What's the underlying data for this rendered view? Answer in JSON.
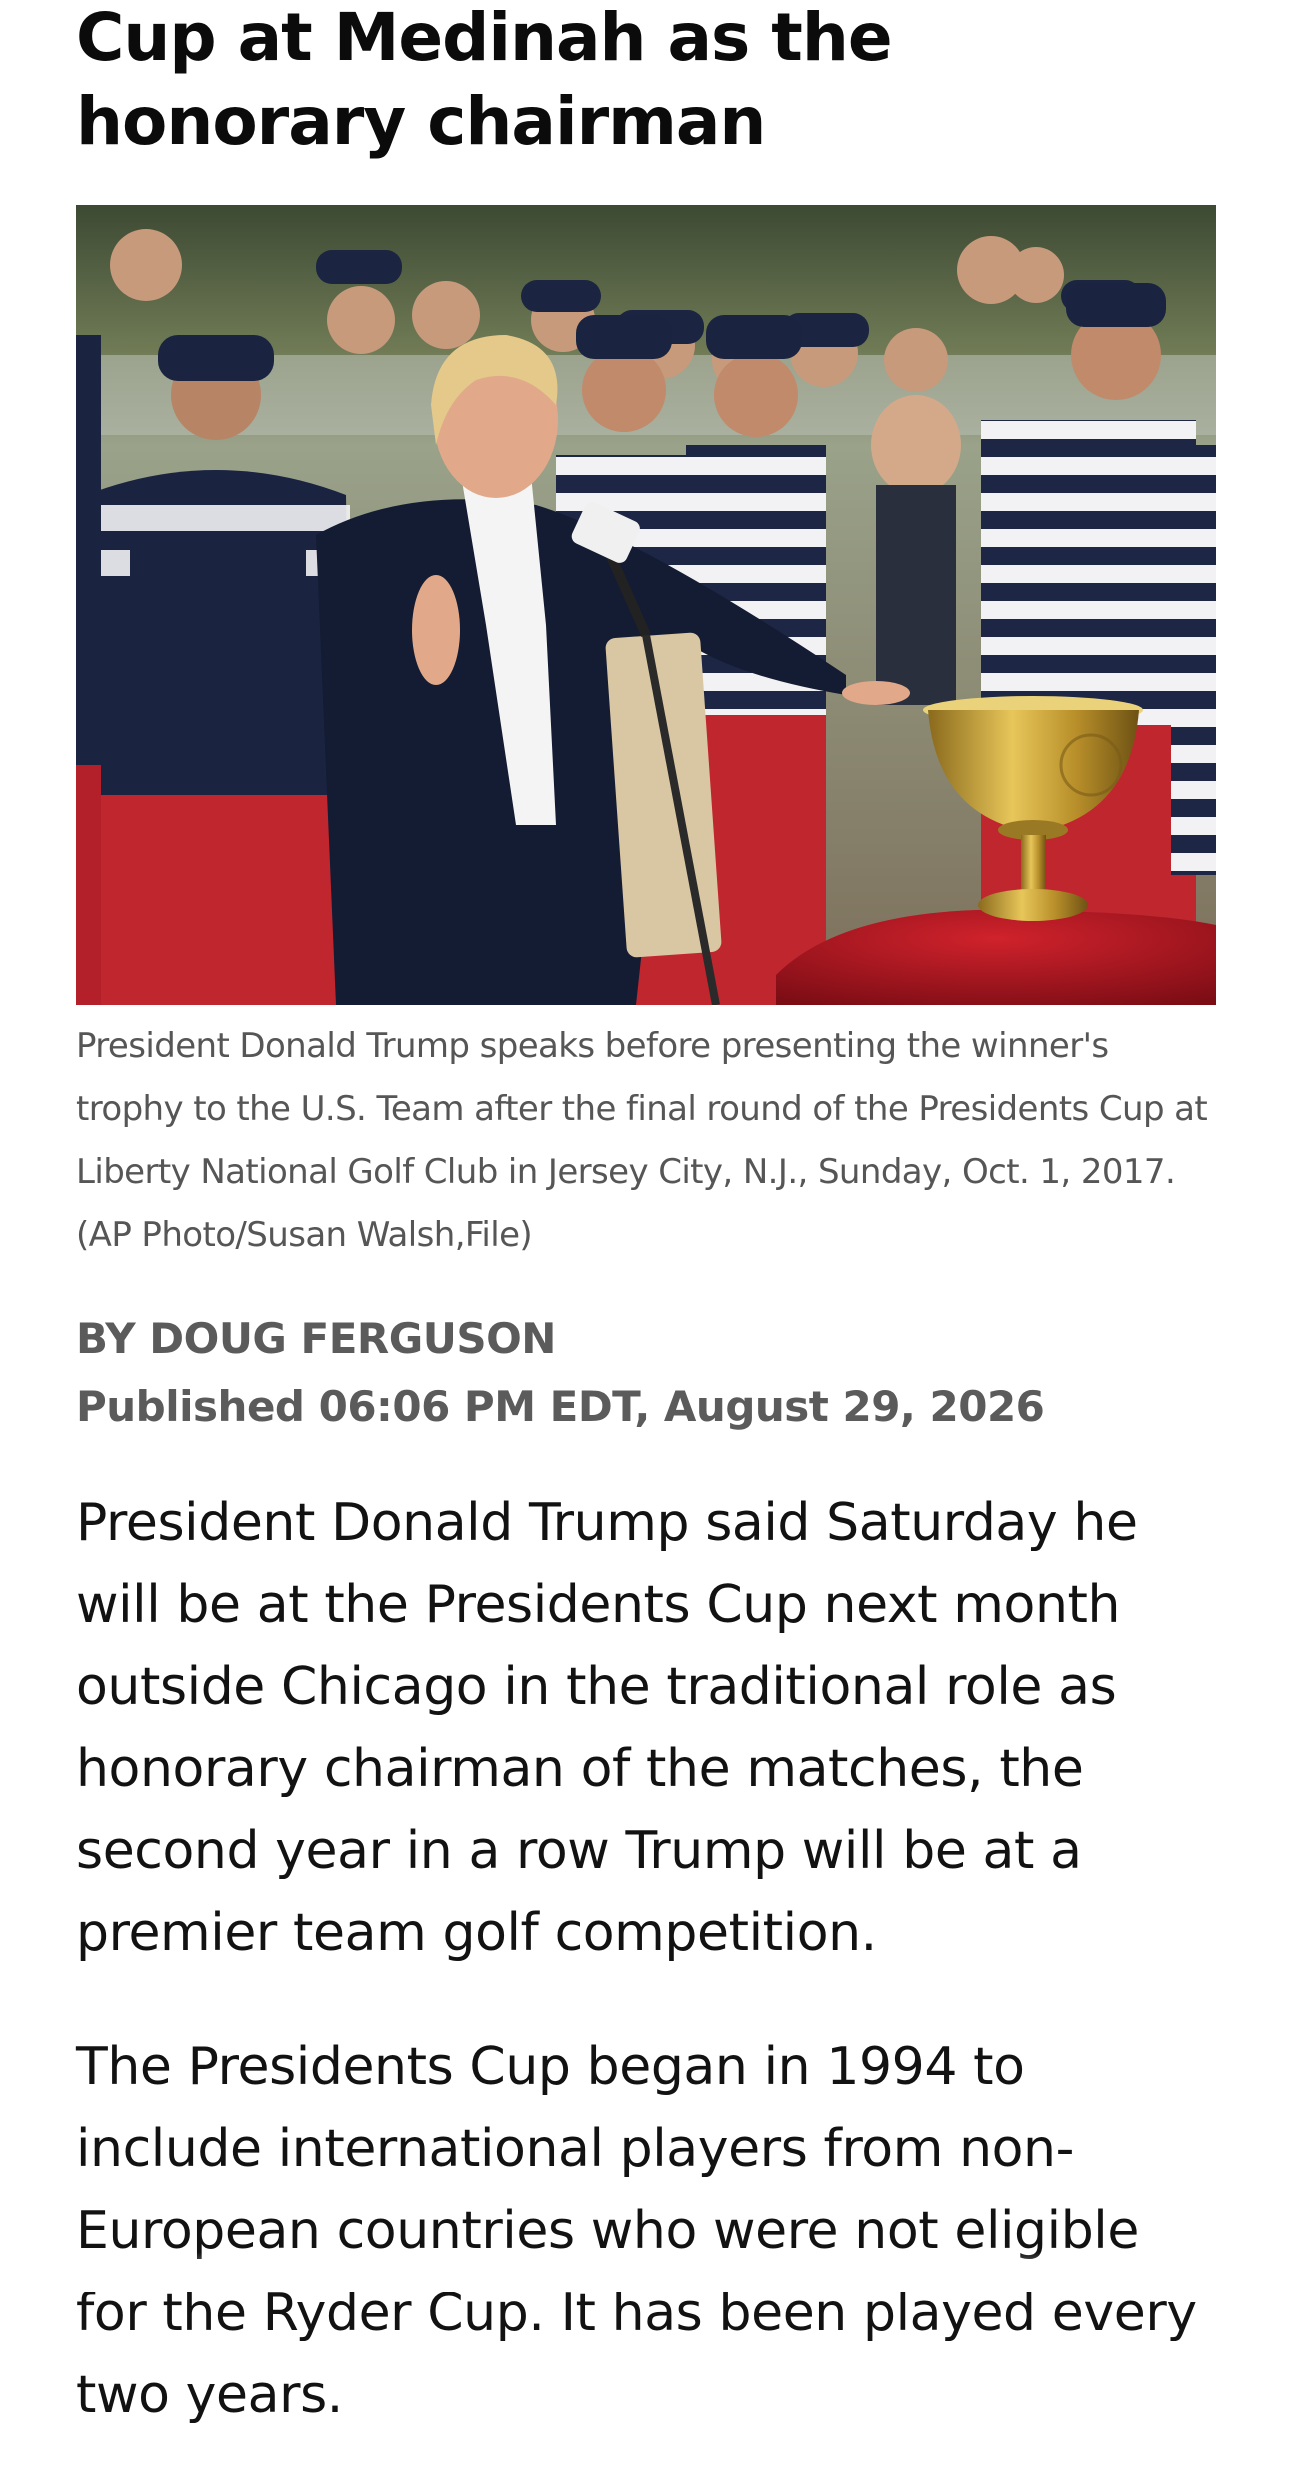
{
  "article": {
    "headline": "Cup at Medinah as the honorary chairman",
    "photo": {
      "icon": "news-photo",
      "caption": "President Donald Trump speaks before presenting the winner's trophy to the U.S. Team after the final round of the Presidents Cup at Liberty National Golf Club in Jersey City, N.J., Sunday, Oct. 1, 2017. (AP Photo/Susan Walsh,File)"
    },
    "byline": "BY DOUG FERGUSON",
    "published": "Published 06:06 PM EDT, August 29, 2026",
    "paragraphs": [
      "President Donald Trump said Saturday he will be at the Presidents Cup next month outside Chicago in the traditional role as honorary chairman of the matches, the second year in a row Trump will be at a premier team golf competition.",
      "The Presidents Cup began in 1994 to include international players from non-European countries who were not eligible for the Ryder Cup. It has been played every two years."
    ]
  },
  "colors": {
    "headline": "#0b0b0b",
    "caption": "#565656",
    "byline": "#5b5b5b",
    "body": "#121212",
    "navy_shirt": "#1c2540",
    "red_pants": "#c0262e",
    "gold_trophy": "#c9a53a"
  }
}
